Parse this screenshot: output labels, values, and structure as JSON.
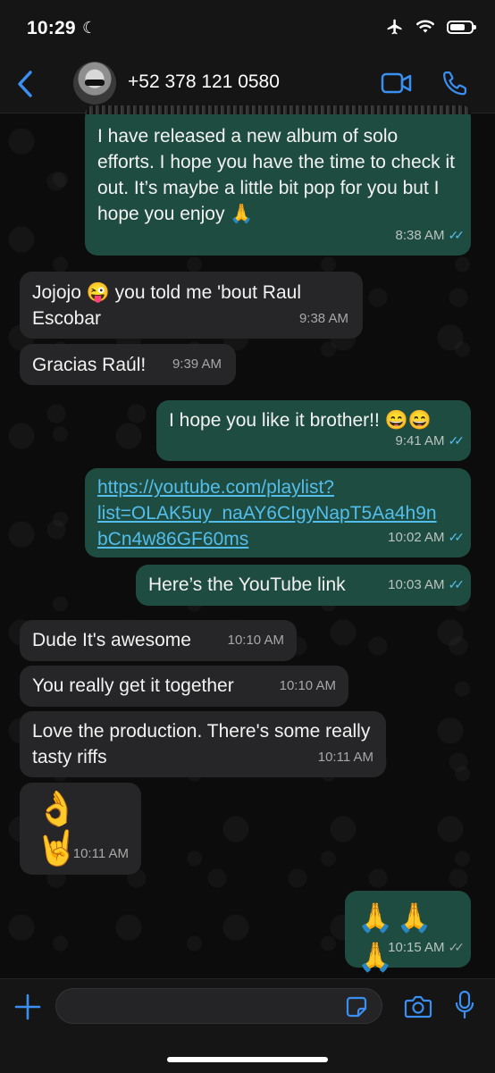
{
  "status_bar": {
    "time": "10:29"
  },
  "header": {
    "contact_name": "+52 378 121 0580"
  },
  "messages": [
    {
      "direction": "out",
      "text": "I have released a new album of solo efforts. I hope you have the time to check it out. It’s maybe a little bit pop for you but I hope you enjoy 🙏",
      "time": "8:38 AM",
      "ticks": "✓✓"
    },
    {
      "direction": "in",
      "text": "Jojojo 😜 you told me 'bout Raul Escobar",
      "time": "9:38 AM"
    },
    {
      "direction": "in",
      "text": "Gracias Raúl!",
      "time": "9:39 AM"
    },
    {
      "direction": "out",
      "text": "I hope you like it brother!! 😄😄",
      "time": "9:41 AM",
      "ticks": "✓✓"
    },
    {
      "direction": "out",
      "text": "https://youtube.com/playlist?list=OLAK5uy_naAY6CIgyNapT5Aa4h9nbCn4w86GF60ms",
      "link_lines": [
        "https://youtube.com/playlist?",
        "list=OLAK5uy_naAY6CIgyNapT5Aa4h9n",
        "bCn4w86GF60ms"
      ],
      "time": "10:02 AM",
      "ticks": "✓✓"
    },
    {
      "direction": "out",
      "text": "Here’s the YouTube link",
      "time": "10:03 AM",
      "ticks": "✓✓"
    },
    {
      "direction": "in",
      "text": "Dude It's awesome",
      "time": "10:10 AM"
    },
    {
      "direction": "in",
      "text": "You really get it together",
      "time": "10:10 AM"
    },
    {
      "direction": "in",
      "text": "Love the production. There's some really tasty riffs",
      "time": "10:11 AM"
    },
    {
      "direction": "in",
      "text": "👌🤘",
      "time": "10:11 AM"
    },
    {
      "direction": "out",
      "text": "🙏🙏🙏",
      "time": "10:15 AM",
      "ticks": "✓✓"
    }
  ],
  "colors": {
    "accent": "#3a8ff0",
    "outgoing_bubble": "#1f4c40",
    "incoming_bubble": "#262628",
    "read_ticks": "#53bdeb"
  },
  "icons": [
    "moon-icon",
    "airplane-icon",
    "wifi-icon",
    "battery-icon",
    "back-icon",
    "video-call-icon",
    "phone-call-icon",
    "plus-icon",
    "sticker-icon",
    "camera-icon",
    "microphone-icon"
  ]
}
